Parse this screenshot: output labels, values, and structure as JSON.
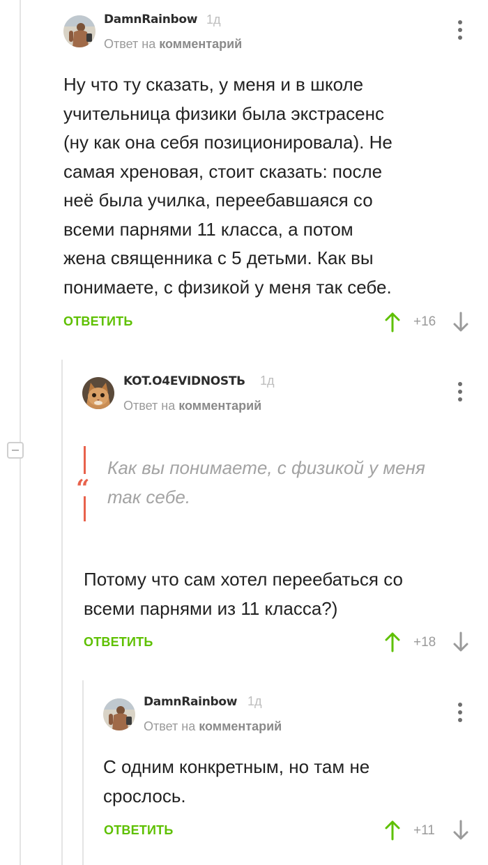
{
  "comments": [
    {
      "username": "DamnRainbow",
      "time": "1д",
      "reply_prefix": "Ответ на",
      "reply_target": "комментарий",
      "lines": [
        "Ну что ту сказать, у меня и в школе",
        "учительница физики была экстрасенс",
        "(ну как она себя позиционировала). Не",
        "самая хреновая, стоит сказать: после",
        "неё была училка, переебавшаяся со",
        "всеми парнями 11 класса, а потом",
        "жена священника с 5 детьми. Как вы",
        "понимаете, с физикой у меня так себе."
      ],
      "reply_label": "ОТВЕТИТЬ",
      "score": "+16"
    },
    {
      "username": "KOT.O4EVIDNOSTЬ",
      "time": "1д",
      "reply_prefix": "Ответ на",
      "reply_target": "комментарий",
      "quote_mark": "“",
      "quote_lines": [
        "Как вы понимаете, с физикой у меня",
        "так себе."
      ],
      "lines": [
        "Потому что сам хотел переебаться со",
        "всеми парнями из 11 класса?)"
      ],
      "reply_label": "ОТВЕТИТЬ",
      "score": "+18"
    },
    {
      "username": "DamnRainbow",
      "time": "1д",
      "reply_prefix": "Ответ на",
      "reply_target": "комментарий",
      "lines": [
        "С одним конкретным, но там не",
        "срослось."
      ],
      "reply_label": "ОТВЕТИТЬ",
      "score": "+11"
    }
  ],
  "colors": {
    "accent_green": "#5ec000",
    "quote_red": "#e8624c",
    "muted_gray": "#9a9a9a"
  },
  "icons": {
    "more": "more-vertical-icon",
    "upvote": "arrow-up-icon",
    "downvote": "arrow-down-icon",
    "collapse": "minus-collapse-icon",
    "quote": "quote-icon"
  }
}
